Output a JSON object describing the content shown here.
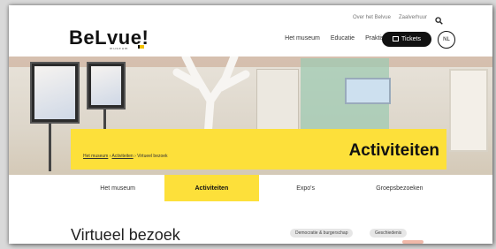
{
  "header": {
    "utility_links": [
      "Over het Belvue",
      "Zaalverhuur"
    ],
    "logo_text": "BeLvue!",
    "logo_subtext": "museum",
    "main_nav": [
      "Het museum",
      "Educatie",
      "Praktische info"
    ],
    "tickets_label": "Tickets",
    "language_label": "NL"
  },
  "hero": {
    "breadcrumb": {
      "links": [
        "Het museum",
        "Activiteiten"
      ],
      "current": "Virtueel bezoek",
      "separator": " › "
    },
    "title": "Activiteiten"
  },
  "tabs": [
    {
      "label": "Het museum",
      "active": false
    },
    {
      "label": "Activiteiten",
      "active": true
    },
    {
      "label": "Expo's",
      "active": false
    },
    {
      "label": "Groepsbezoeken",
      "active": false
    }
  ],
  "content": {
    "title": "Virtueel bezoek",
    "tags": [
      "Democratie & burgerschap",
      "Geschiedenis"
    ]
  },
  "colors": {
    "accent": "#fde03a",
    "dark": "#111111"
  }
}
